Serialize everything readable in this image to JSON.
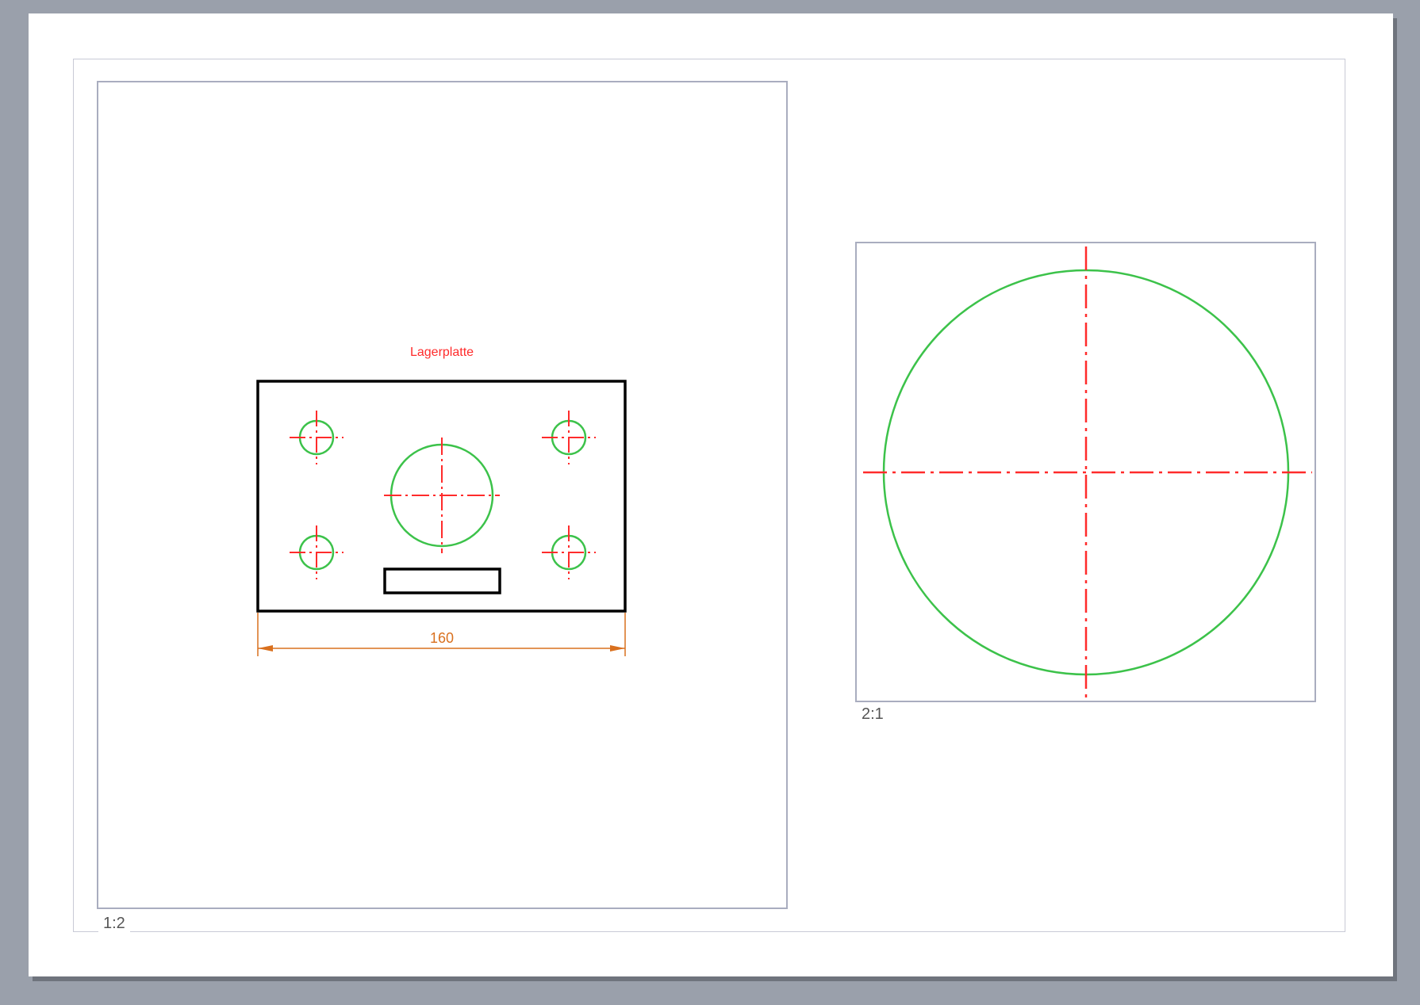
{
  "sheet": {
    "background_color": "#ffffff",
    "frame_color": "#c8cad6"
  },
  "views": {
    "main": {
      "scale_label": "1:2",
      "title": "Lagerplatte",
      "dimension_text": "160"
    },
    "detail": {
      "scale_label": "2:1"
    }
  },
  "colors": {
    "outline": "#000000",
    "hole": "#3cc24a",
    "centerline": "#ff2b2b",
    "dimension": "#d9701e",
    "title": "#ff2b2b"
  }
}
